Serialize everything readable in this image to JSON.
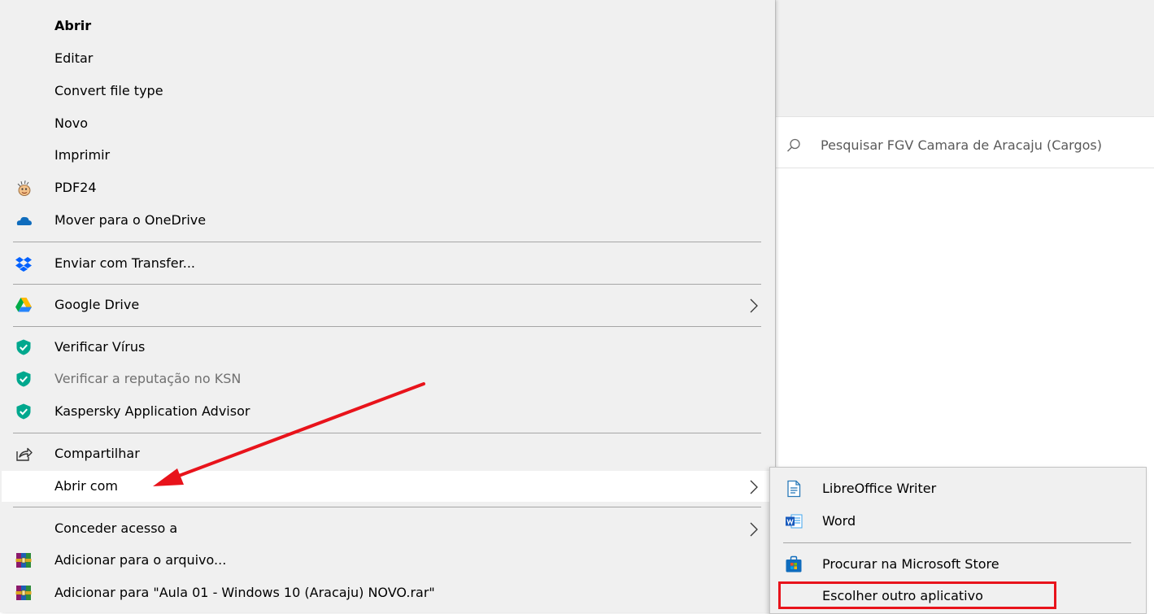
{
  "explorer": {
    "search_placeholder": "Pesquisar FGV Camara de Aracaju (Cargos)"
  },
  "context_menu": {
    "items": [
      {
        "label": "Abrir",
        "icon": "none",
        "bold": true
      },
      {
        "label": "Editar",
        "icon": "none"
      },
      {
        "label": "Convert file type",
        "icon": "none"
      },
      {
        "label": "Novo",
        "icon": "none"
      },
      {
        "label": "Imprimir",
        "icon": "none"
      },
      {
        "label": "PDF24",
        "icon": "pdf24-icon"
      },
      {
        "label": "Mover para o OneDrive",
        "icon": "onedrive-cloud-icon"
      },
      {
        "label": "Enviar com Transfer...",
        "icon": "dropbox-icon"
      },
      {
        "label": "Google Drive",
        "icon": "google-drive-icon",
        "submenu": true
      },
      {
        "label": "Verificar Vírus",
        "icon": "kaspersky-shield-icon"
      },
      {
        "label": "Verificar a reputação no KSN",
        "icon": "kaspersky-shield-icon",
        "disabled": true
      },
      {
        "label": "Kaspersky Application Advisor",
        "icon": "kaspersky-shield-icon"
      },
      {
        "label": "Compartilhar",
        "icon": "share-icon"
      },
      {
        "label": "Abrir com",
        "icon": "none",
        "submenu": true,
        "highlighted": true
      },
      {
        "label": "Conceder acesso a",
        "icon": "none",
        "submenu": true
      },
      {
        "label": "Adicionar para o arquivo...",
        "icon": "winrar-icon"
      },
      {
        "label": "Adicionar para \"Aula 01 - Windows 10 (Aracaju) NOVO.rar\"",
        "icon": "winrar-icon"
      }
    ]
  },
  "open_with_submenu": {
    "items": [
      {
        "label": "LibreOffice Writer",
        "icon": "libreoffice-writer-icon"
      },
      {
        "label": "Word",
        "icon": "word-icon"
      },
      {
        "label": "Procurar na Microsoft Store",
        "icon": "microsoft-store-icon"
      },
      {
        "label": "Escolher outro aplicativo",
        "icon": "none",
        "annotated": true
      }
    ]
  },
  "annotation": {
    "color": "#e8131b"
  }
}
